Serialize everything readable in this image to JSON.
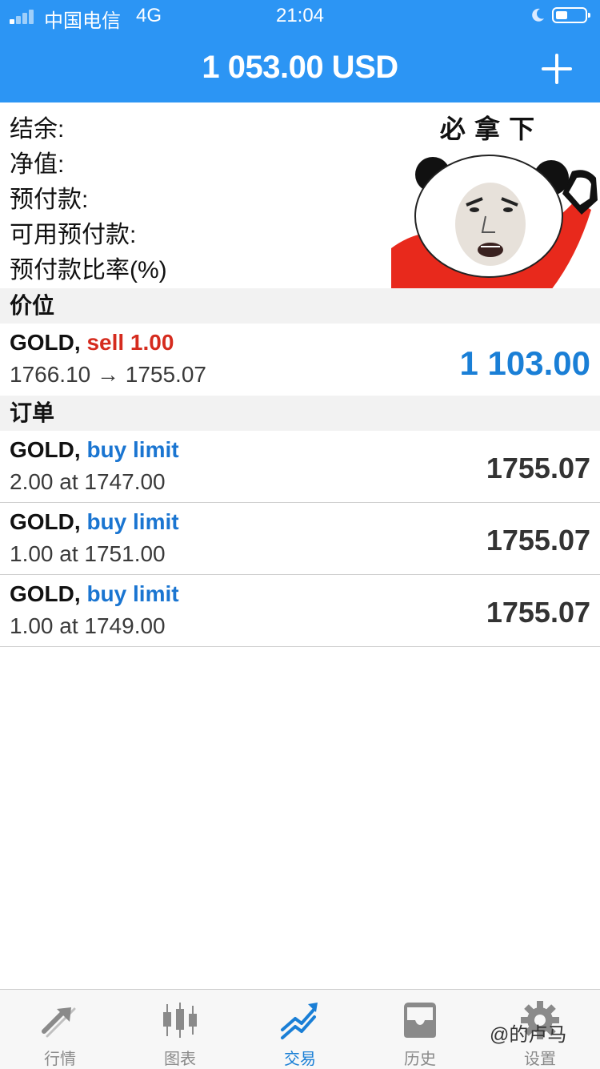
{
  "status_bar": {
    "carrier": "中国电信",
    "network": "4G",
    "time": "21:04"
  },
  "header": {
    "balance": "1 053.00 USD",
    "add_icon": "plus-icon"
  },
  "summary": {
    "labels": [
      "结余:",
      "净值:",
      "预付款:",
      "可用预付款:",
      "预付款比率(%)"
    ],
    "meme_text": "必 拿 下"
  },
  "positions": {
    "header": "价位",
    "items": [
      {
        "symbol": "GOLD,",
        "action": "sell 1.00",
        "prices": "1766.10 → 1755.07",
        "profit": "1 103.00"
      }
    ]
  },
  "orders": {
    "header": "订单",
    "items": [
      {
        "symbol": "GOLD,",
        "type": "buy limit",
        "detail": "2.00 at 1747.00",
        "price": "1755.07"
      },
      {
        "symbol": "GOLD,",
        "type": "buy limit",
        "detail": "1.00 at 1751.00",
        "price": "1755.07"
      },
      {
        "symbol": "GOLD,",
        "type": "buy limit",
        "detail": "1.00 at 1749.00",
        "price": "1755.07"
      }
    ]
  },
  "tabs": [
    {
      "label": "行情",
      "icon": "quotes-icon",
      "active": false
    },
    {
      "label": "图表",
      "icon": "chart-icon",
      "active": false
    },
    {
      "label": "交易",
      "icon": "trade-icon",
      "active": true
    },
    {
      "label": "历史",
      "icon": "history-icon",
      "active": false
    },
    {
      "label": "设置",
      "icon": "settings-icon",
      "active": false
    }
  ],
  "watermark": "@的卢马",
  "colors": {
    "header_bg": "#2c95f4",
    "sell": "#d52b1e",
    "buy": "#1a75d1",
    "profit": "#1a7fd6",
    "tab_active": "#1a7fd6",
    "tab_inactive": "#8a8a8a"
  }
}
